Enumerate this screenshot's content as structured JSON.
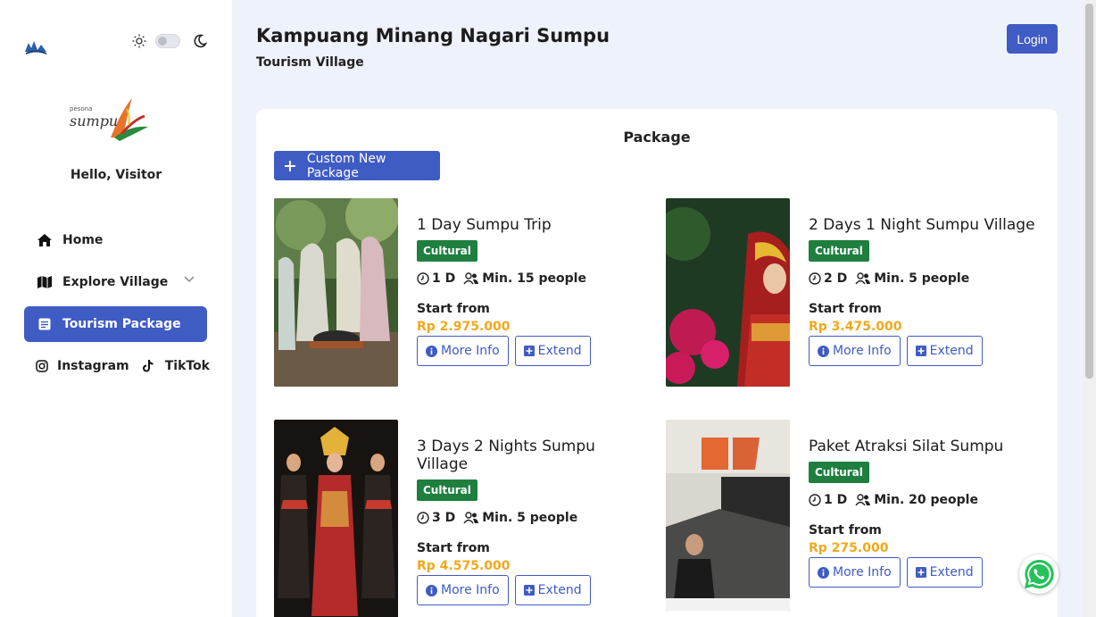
{
  "sidebar": {
    "greeting": "Hello, Visitor",
    "brand_small": "pesona",
    "brand_word": "sumpu",
    "items": [
      {
        "label": "Home",
        "icon": "home-icon"
      },
      {
        "label": "Explore Village",
        "icon": "map-icon"
      },
      {
        "label": "Tourism Package",
        "icon": "package-icon",
        "active": true
      },
      {
        "label": "Instagram",
        "icon": "instagram-icon"
      },
      {
        "label": "TikTok",
        "icon": "tiktok-icon"
      }
    ]
  },
  "header": {
    "title": "Kampuang Minang Nagari Sumpu",
    "subtitle": "Tourism Village",
    "login_label": "Login"
  },
  "main": {
    "card_title": "Package",
    "custom_button_label": "Custom New Package",
    "packages": [
      {
        "name": "1 Day Sumpu Trip",
        "category": "Cultural",
        "duration": "1 D",
        "min_people": "Min. 15 people",
        "start_label": "Start from",
        "price": "Rp 2.975.000",
        "more_label": "More Info",
        "extend_label": "Extend"
      },
      {
        "name": "2 Days 1 Night Sumpu Village",
        "category": "Cultural",
        "duration": "2 D",
        "min_people": "Min. 5 people",
        "start_label": "Start from",
        "price": "Rp 3.475.000",
        "more_label": "More Info",
        "extend_label": "Extend"
      },
      {
        "name": "3 Days 2 Nights Sumpu Village",
        "category": "Cultural",
        "duration": "3 D",
        "min_people": "Min. 5 people",
        "start_label": "Start from",
        "price": "Rp 4.575.000",
        "more_label": "More Info",
        "extend_label": "Extend"
      },
      {
        "name": "Paket Atraksi Silat Sumpu",
        "category": "Cultural",
        "duration": "1 D",
        "min_people": "Min. 20 people",
        "start_label": "Start from",
        "price": "Rp 275.000",
        "more_label": "More Info",
        "extend_label": "Extend"
      }
    ]
  },
  "colors": {
    "accent": "#3f5bc4",
    "badge": "#1e7f3e",
    "price": "#f2a81a",
    "background": "#eef2fa"
  }
}
